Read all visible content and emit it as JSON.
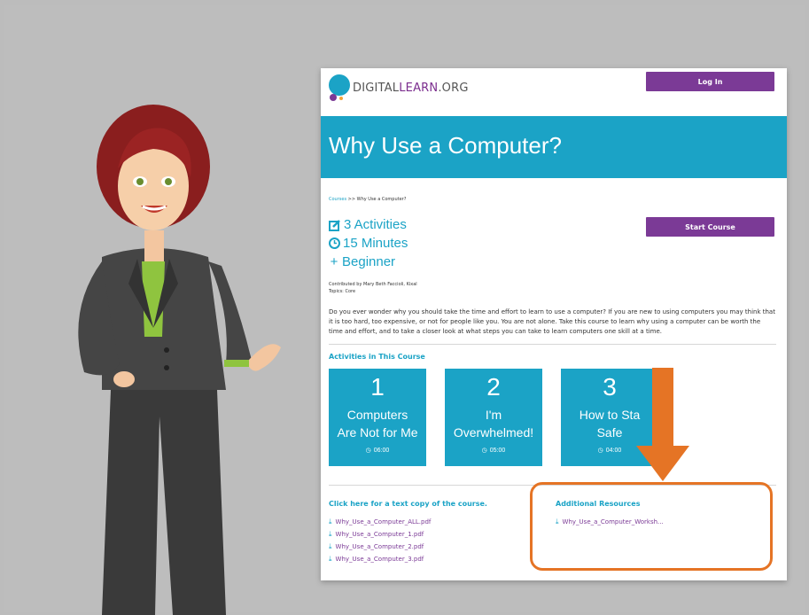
{
  "site": {
    "logo_text_a": "DIGITAL",
    "logo_text_b": "LEARN",
    "logo_text_c": ".ORG",
    "login_label": "Log In"
  },
  "course": {
    "title": "Why Use a Computer?",
    "breadcrumb_link": "Courses",
    "breadcrumb_rest": " >> Why Use a Computer?",
    "activities": "3 Activities",
    "duration": "15 Minutes",
    "level": "Beginner",
    "start_label": "Start Course",
    "contributed": "Contributed by Mary Beth Faccioli, Kixal",
    "topics": "Topics: Core",
    "description": "Do you ever wonder why you should take the time and effort to learn to use a computer? If you are new to using computers you may think that it is too hard, too expensive, or not for people like you. You are not alone. Take this course to learn why using a computer can be worth the time and effort, and to take a closer look at what steps you can take to learn computers one skill at a time."
  },
  "activities_heading": "Activities in This Course",
  "activities": [
    {
      "number": "1",
      "title_line1": "Computers",
      "title_line2": "Are Not for Me",
      "time": "06:00"
    },
    {
      "number": "2",
      "title_line1": "I'm",
      "title_line2": "Overwhelmed!",
      "time": "05:00"
    },
    {
      "number": "3",
      "title_line1": "How to Sta",
      "title_line2": "Safe",
      "time": "04:00"
    }
  ],
  "text_copy_heading": "Click here for a text copy of the course.",
  "files": [
    "Why_Use_a_Computer_ALL.pdf",
    "Why_Use_a_Computer_1.pdf",
    "Why_Use_a_Computer_2.pdf",
    "Why_Use_a_Computer_3.pdf"
  ],
  "resources_heading": "Additional Resources",
  "resources": [
    "Why_Use_a_Computer_Worksh..."
  ],
  "colors": {
    "accent": "#1ba3c6",
    "purple": "#7b3a96",
    "highlight": "#e57425",
    "background": "#bdbdbd"
  }
}
